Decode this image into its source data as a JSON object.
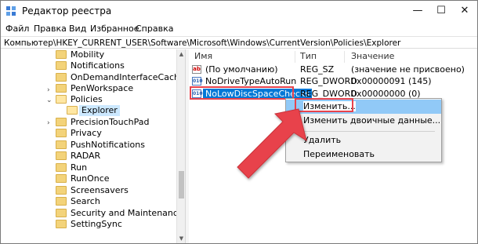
{
  "window": {
    "title": "Редактор реестра",
    "controls": {
      "minimize": "—",
      "maximize": "☐",
      "close": "✕"
    }
  },
  "menu": [
    "Файл",
    "Правка",
    "Вид",
    "Избранное",
    "Справка"
  ],
  "address": "Компьютер\\HKEY_CURRENT_USER\\Software\\Microsoft\\Windows\\CurrentVersion\\Policies\\Explorer",
  "tree": {
    "items": [
      {
        "label": "Mobility"
      },
      {
        "label": "Notifications"
      },
      {
        "label": "OnDemandInterfaceCache"
      },
      {
        "label": "PenWorkspace"
      },
      {
        "label": "Policies",
        "expanded": true
      },
      {
        "label": "Explorer",
        "selected": true
      },
      {
        "label": "PrecisionTouchPad"
      },
      {
        "label": "Privacy"
      },
      {
        "label": "PushNotifications"
      },
      {
        "label": "RADAR"
      },
      {
        "label": "Run"
      },
      {
        "label": "RunOnce"
      },
      {
        "label": "Screensavers"
      },
      {
        "label": "Search"
      },
      {
        "label": "Security and Maintenance"
      },
      {
        "label": "SettingSync"
      }
    ]
  },
  "list": {
    "columns": {
      "name": "Имя",
      "type": "Тип",
      "value": "Значение"
    },
    "rows": [
      {
        "icon": "ab",
        "name": "(По умолчанию)",
        "type": "REG_SZ",
        "value": "(значение не присвоено)"
      },
      {
        "icon": "010",
        "name": "NoDriveTypeAutoRun",
        "type": "REG_DWORD",
        "value": "0x00000091 (145)"
      },
      {
        "icon": "010",
        "name": "NoLowDiscSpaceChecks",
        "type": "REG_DWORD",
        "value": "0x00000000 (0)"
      }
    ]
  },
  "context_menu": {
    "items": [
      "Изменить...",
      "Изменить двоичные данные...",
      "Удалить",
      "Переименовать"
    ]
  },
  "colors": {
    "accent": "#0078d7",
    "annotation": "#e8434c"
  }
}
